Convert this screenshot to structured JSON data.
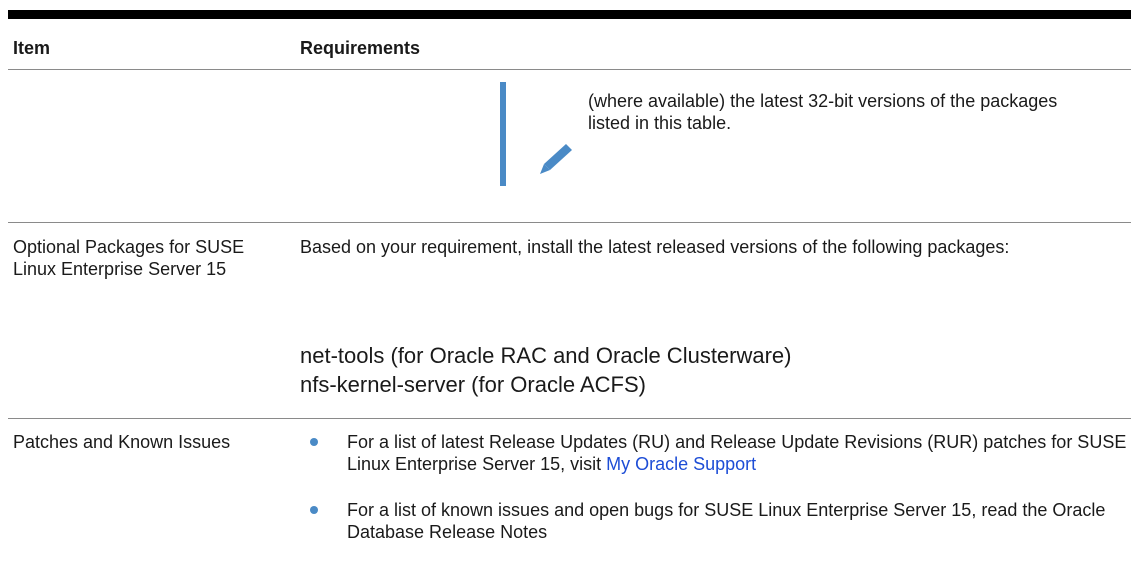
{
  "table": {
    "headers": {
      "item": "Item",
      "requirements": "Requirements"
    },
    "note": {
      "icon": "pencil-icon",
      "text": "(where available) the latest 32-bit versions of the packages listed in this table."
    },
    "rows": [
      {
        "item": "Optional Packages for SUSE Linux Enterprise Server 15",
        "requirement": "Based on your requirement, install the latest released versions of the following packages:",
        "packages": [
          "net-tools (for Oracle RAC and Oracle Clusterware)",
          "nfs-kernel-server (for Oracle ACFS)"
        ]
      },
      {
        "item": "Patches and Known Issues",
        "bullets": [
          {
            "text": "For a list of latest Release Updates (RU) and Release Update Revisions (RUR) patches for SUSE Linux Enterprise Server 15, visit ",
            "link": "My Oracle Support"
          },
          {
            "text": "For a list of known issues and open bugs for SUSE Linux Enterprise Server 15, read the Oracle Database Release Notes"
          }
        ]
      }
    ]
  },
  "colors": {
    "accent": "#4a8ac6",
    "link": "#1d4dd6"
  }
}
